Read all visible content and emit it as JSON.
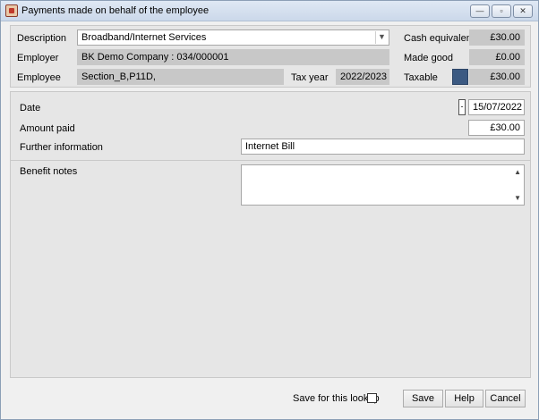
{
  "window": {
    "title": "Payments made on behalf of the employee",
    "minimize_glyph": "—",
    "maximize_glyph": "▫",
    "close_glyph": "✕"
  },
  "header": {
    "description_label": "Description",
    "description_value": "Broadband/Internet Services",
    "employer_label": "Employer",
    "employer_value": "BK Demo Company : 034/000001",
    "employee_label": "Employee",
    "employee_value": "Section_B,P11D,",
    "tax_year_label": "Tax year",
    "tax_year_value": "2022/2023",
    "cash_equivalent_label": "Cash equivalent",
    "cash_equivalent_value": "£30.00",
    "made_good_label": "Made good",
    "made_good_value": "£0.00",
    "taxable_label": "Taxable",
    "taxable_value": "£30.00",
    "taxable_swatch_color": "#3c5a82"
  },
  "details": {
    "date_label": "Date",
    "date_value": "15/07/2022",
    "date_spin_glyph": "-",
    "amount_label": "Amount paid",
    "amount_value": "£30.00",
    "further_info_label": "Further information",
    "further_info_value": "Internet Bill",
    "benefit_notes_label": "Benefit notes",
    "benefit_notes_value": ""
  },
  "footer": {
    "save_lookup_label": "Save for this lookup",
    "save_label": "Save",
    "help_label": "Help",
    "cancel_label": "Cancel"
  }
}
